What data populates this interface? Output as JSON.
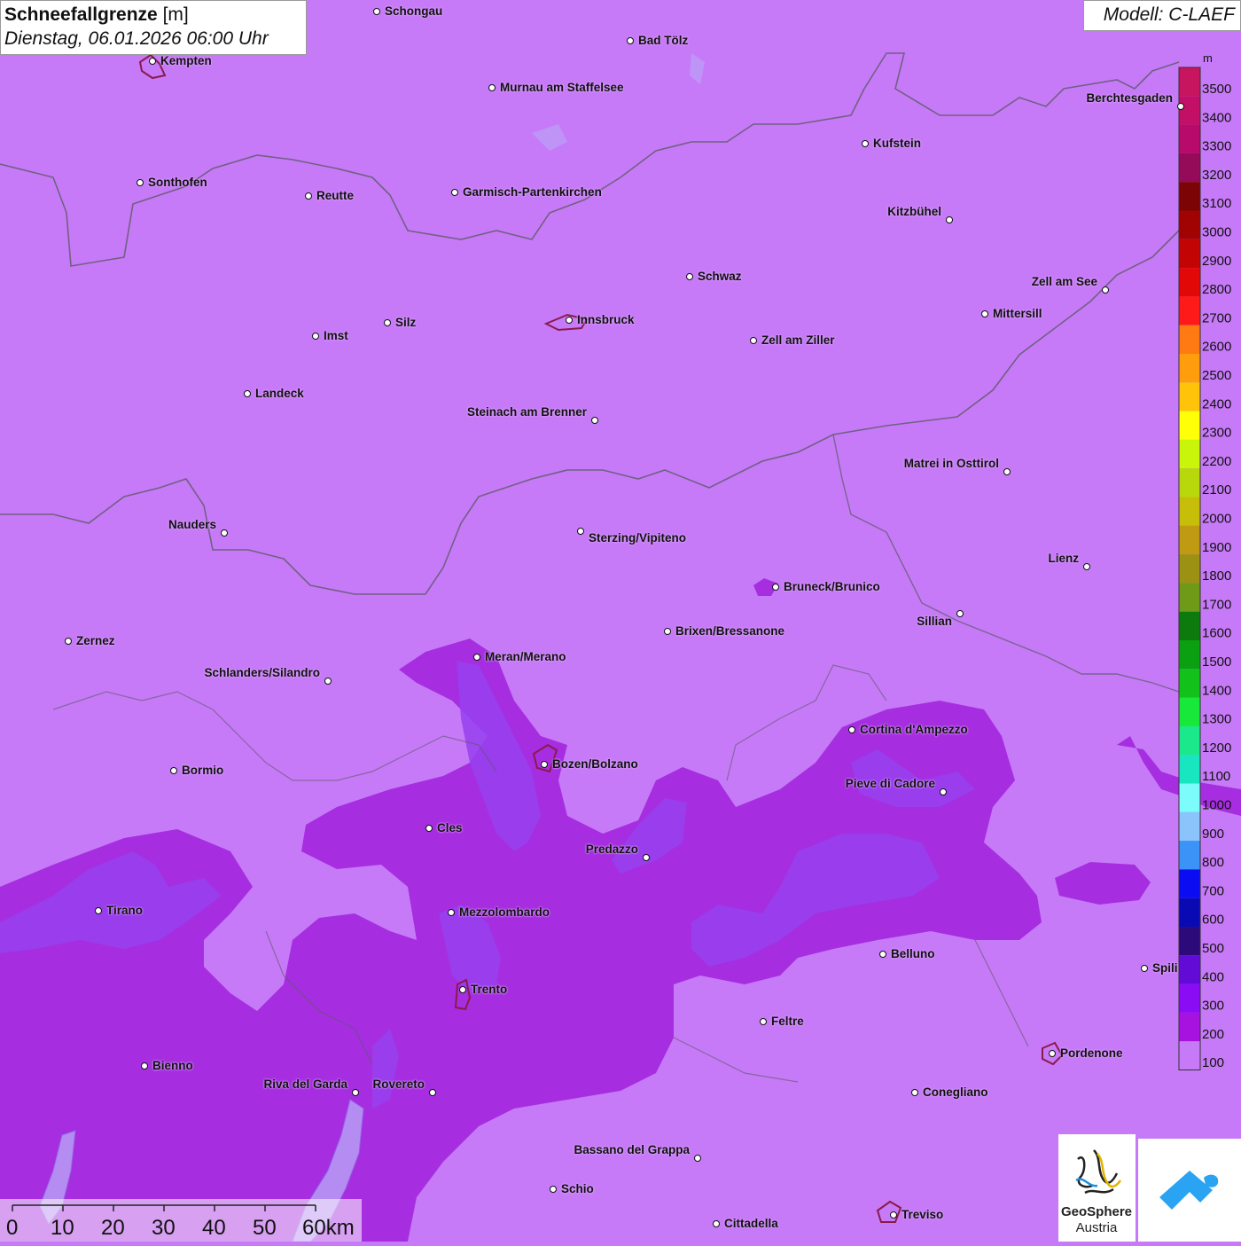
{
  "title": {
    "main": "Schneefallgrenze",
    "unit": "[m]",
    "datetime": "Dienstag, 06.01.2026 06:00 Uhr"
  },
  "model": "Modell: C-LAEF",
  "legend": {
    "unit": "m",
    "levels": [
      {
        "label": "3500",
        "color": "#c8155f"
      },
      {
        "label": "3400",
        "color": "#c40f66"
      },
      {
        "label": "3300",
        "color": "#b70a6a"
      },
      {
        "label": "3200",
        "color": "#950a59"
      },
      {
        "label": "3100",
        "color": "#7c0404"
      },
      {
        "label": "3000",
        "color": "#a10303"
      },
      {
        "label": "2900",
        "color": "#c20404"
      },
      {
        "label": "2800",
        "color": "#e20808"
      },
      {
        "label": "2700",
        "color": "#ff1a1a"
      },
      {
        "label": "2600",
        "color": "#ff7a12"
      },
      {
        "label": "2500",
        "color": "#ff9d0c"
      },
      {
        "label": "2400",
        "color": "#ffc40a"
      },
      {
        "label": "2300",
        "color": "#ffff08"
      },
      {
        "label": "2200",
        "color": "#c8f50a"
      },
      {
        "label": "2100",
        "color": "#b9d80c"
      },
      {
        "label": "2000",
        "color": "#c7be0a"
      },
      {
        "label": "1900",
        "color": "#c09a12"
      },
      {
        "label": "1800",
        "color": "#9c9112"
      },
      {
        "label": "1700",
        "color": "#6e9a18"
      },
      {
        "label": "1600",
        "color": "#0c7a0c"
      },
      {
        "label": "1500",
        "color": "#0aa012"
      },
      {
        "label": "1400",
        "color": "#12c21a"
      },
      {
        "label": "1300",
        "color": "#18e83a"
      },
      {
        "label": "1200",
        "color": "#1ae88a"
      },
      {
        "label": "1100",
        "color": "#18e6c0"
      },
      {
        "label": "1000",
        "color": "#7cfcfa"
      },
      {
        "label": "900",
        "color": "#8ac4fb"
      },
      {
        "label": "800",
        "color": "#3c93f7"
      },
      {
        "label": "700",
        "color": "#0c0cf2"
      },
      {
        "label": "600",
        "color": "#0a0ab5"
      },
      {
        "label": "500",
        "color": "#2c0a7a"
      },
      {
        "label": "400",
        "color": "#620ad6"
      },
      {
        "label": "300",
        "color": "#8a0cf5"
      },
      {
        "label": "200",
        "color": "#a812e0"
      },
      {
        "label": "100",
        "color": "#c77af7"
      }
    ]
  },
  "scale_bar": {
    "labels": [
      "0",
      "10",
      "20",
      "30",
      "40",
      "50",
      "60km"
    ]
  },
  "logos": {
    "geosphere_line1": "GeoSphere",
    "geosphere_line2": "Austria"
  },
  "cities": [
    {
      "name": "Schongau"
    },
    {
      "name": "Bad Tölz"
    },
    {
      "name": "Kempten"
    },
    {
      "name": "Murnau am Staffelsee"
    },
    {
      "name": "Berchtesgaden"
    },
    {
      "name": "Kufstein"
    },
    {
      "name": "Sonthofen"
    },
    {
      "name": "Reutte"
    },
    {
      "name": "Garmisch-Partenkirchen"
    },
    {
      "name": "Kitzbühel"
    },
    {
      "name": "Schwaz"
    },
    {
      "name": "Zell am See"
    },
    {
      "name": "Mittersill"
    },
    {
      "name": "Innsbruck"
    },
    {
      "name": "Silz"
    },
    {
      "name": "Imst"
    },
    {
      "name": "Zell am Ziller"
    },
    {
      "name": "Landeck"
    },
    {
      "name": "Steinach am Brenner"
    },
    {
      "name": "Matrei in Osttirol"
    },
    {
      "name": "Nauders"
    },
    {
      "name": "Sterzing/Vipiteno"
    },
    {
      "name": "Lienz"
    },
    {
      "name": "Bruneck/Brunico"
    },
    {
      "name": "Sillian"
    },
    {
      "name": "Zernez"
    },
    {
      "name": "Brixen/Bressanone"
    },
    {
      "name": "Meran/Merano"
    },
    {
      "name": "Schlanders/Silandro"
    },
    {
      "name": "Cortina d'Ampezzo"
    },
    {
      "name": "Bozen/Bolzano"
    },
    {
      "name": "Bormio"
    },
    {
      "name": "Pieve di Cadore"
    },
    {
      "name": "Cles"
    },
    {
      "name": "Predazzo"
    },
    {
      "name": "Tirano"
    },
    {
      "name": "Mezzolombardo"
    },
    {
      "name": "Belluno"
    },
    {
      "name": "Spili"
    },
    {
      "name": "Trento"
    },
    {
      "name": "Feltre"
    },
    {
      "name": "Pordenone"
    },
    {
      "name": "Bienno"
    },
    {
      "name": "Riva del Garda"
    },
    {
      "name": "Rovereto"
    },
    {
      "name": "Conegliano"
    },
    {
      "name": "Bassano del Grappa"
    },
    {
      "name": "Schio"
    },
    {
      "name": "Treviso"
    },
    {
      "name": "Cittadella"
    }
  ]
}
